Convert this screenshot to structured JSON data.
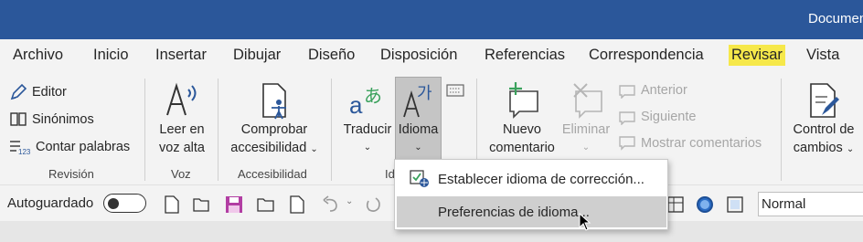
{
  "title": {
    "text": "Documen"
  },
  "tabs": [
    {
      "label": "Archivo"
    },
    {
      "label": "Inicio"
    },
    {
      "label": "Insertar"
    },
    {
      "label": "Dibujar"
    },
    {
      "label": "Diseño"
    },
    {
      "label": "Disposición"
    },
    {
      "label": "Referencias"
    },
    {
      "label": "Correspondencia"
    },
    {
      "label": "Revisar",
      "active": true
    },
    {
      "label": "Vista"
    }
  ],
  "ribbon": {
    "revision": {
      "editor": "Editor",
      "sinonimos": "Sinónimos",
      "contar": "Contar palabras",
      "group": "Revisión"
    },
    "voz": {
      "line1": "Leer en",
      "line2": "voz alta",
      "group": "Voz"
    },
    "accesibilidad": {
      "line1": "Comprobar",
      "line2": "accesibilidad",
      "group": "Accesibilidad"
    },
    "idioma": {
      "traducir": "Traducir",
      "idioma": "Idioma",
      "group": "Id"
    },
    "comentarios": {
      "nuevo1": "Nuevo",
      "nuevo2": "comentario",
      "eliminar": "Eliminar",
      "anterior": "Anterior",
      "siguiente": "Siguiente",
      "mostrar": "Mostrar comentarios"
    },
    "seguimiento": {
      "line1": "Control de",
      "line2": "cambios"
    }
  },
  "menu": {
    "items": [
      {
        "label": "Establecer idioma de corrección..."
      },
      {
        "label": "Preferencias de idioma..."
      }
    ]
  },
  "qat": {
    "autosave_label": "Autoguardado",
    "style_value": "Normal"
  },
  "colors": {
    "titlebar": "#2b579a",
    "active_tab_highlight": "#f6e84a",
    "accent_blue": "#2b579a",
    "comment_green": "#3aa15c"
  }
}
